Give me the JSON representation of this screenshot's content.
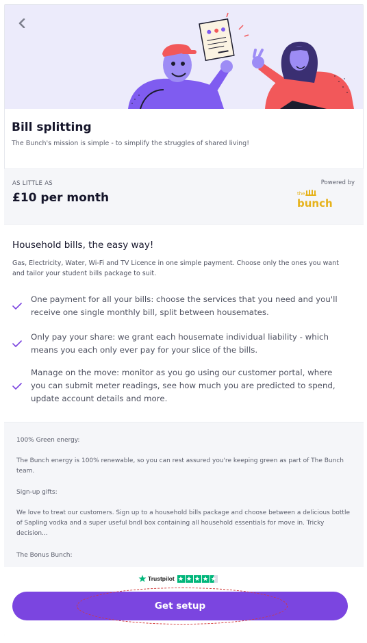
{
  "header": {
    "back_icon": "chevron-left-icon"
  },
  "product": {
    "title": "Bill splitting",
    "subtitle": "The Bunch's mission is simple - to simplify the struggles of shared living!"
  },
  "pricing": {
    "label": "AS LITTLE AS",
    "value": "£10 per month",
    "powered_by": "Powered by",
    "logo_small": "the",
    "logo_large": "bunch",
    "logo_color": "#e6b21a"
  },
  "features": {
    "title": "Household bills, the easy way!",
    "description": "Gas, Electricity, Water, Wi-Fi and TV Licence in one simple payment. Choose only the ones you want and tailor your student bills package to suit.",
    "items": [
      {
        "icon": "check-icon",
        "text": "One payment for all your bills: choose the services that you need and you'll receive one single monthly bill, split between housemates."
      },
      {
        "icon": "check-icon",
        "text": "Only pay your share: we grant each housemate individual liability - which means you each only ever pay for your slice of the bills."
      },
      {
        "icon": "check-icon",
        "text": "Manage on the move: monitor as you go using our customer portal, where you can submit meter readings, see how much you are predicted to spend, update account details and more."
      }
    ]
  },
  "extra": {
    "lines": [
      "100% Green energy:",
      "The Bunch energy is 100% renewable, so you can rest assured you're keeping green as part of The Bunch team.",
      "Sign-up gifts:",
      "We love to treat our customers. Sign up to a household bills package and choose between a delicious bottle of Sapling vodka and a super useful bndl box containing all household essentials for move in. Tricky decision...",
      "The Bonus Bunch:"
    ]
  },
  "footer": {
    "trustpilot_label": "Trustpilot",
    "trustpilot_rating": 4.5,
    "cta_label": "Get setup",
    "accent_color": "#7b45e0"
  }
}
